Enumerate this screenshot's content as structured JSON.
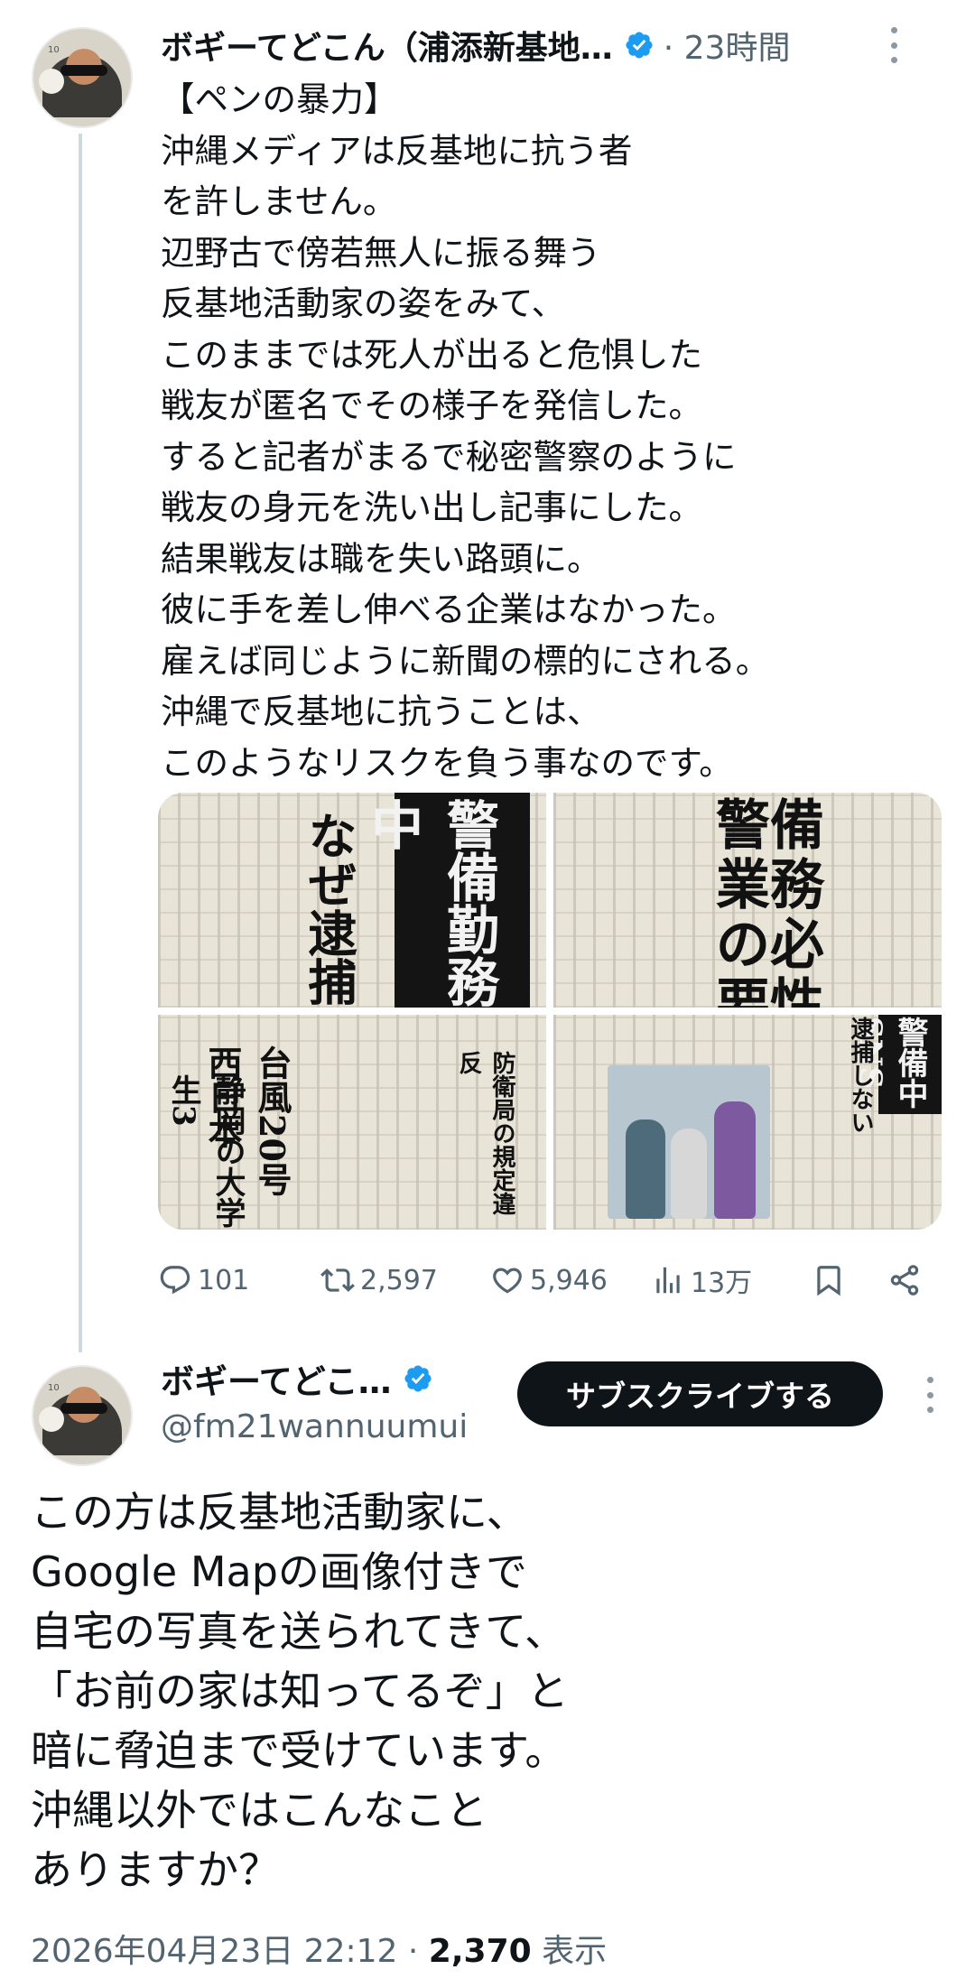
{
  "tweet1": {
    "display_name": "ボギーてどこん（浦添新基地…",
    "verified": true,
    "time_ago": "· 23時間",
    "text": "【ペンの暴力】\n沖縄メディアは反基地に抗う者\nを許しません。\n辺野古で傍若無人に振る舞う\n反基地活動家の姿をみて、\nこのままでは死人が出ると危惧した\n戦友が匿名でその様子を発信した。\nすると記者がまるで秘密警察のように\n戦友の身元を洗い出し記事にした。\n結果戦友は職を失い路頭に。\n彼に手を差し伸べる企業はなかった。\n雇えば同じように新聞の標的にされる。\n沖縄で反基地に抗うことは、\nこのようなリスクを負う事なのです。",
    "images": [
      {
        "headlines": [
          "なぜ逮捕",
          "警備勤務中"
        ]
      },
      {
        "headlines": [
          "警備業務の必要性"
        ]
      },
      {
        "headlines": [
          "台風20号 西日本",
          "静岡の大学生3",
          "防衛局の規定違反"
        ]
      },
      {
        "headlines": [
          "警備中SNS",
          "逮捕しない"
        ]
      }
    ],
    "actions": {
      "replies": "101",
      "reposts": "2,597",
      "likes": "5,946",
      "views": "13万"
    }
  },
  "tweet2": {
    "display_name": "ボギーてどこ…",
    "handle": "@fm21wannuumui",
    "subscribe_label": "サブスクライブする",
    "text": "この方は反基地活動家に、\nGoogle Mapの画像付きで\n自宅の写真を送られてきて、\n「お前の家は知ってるぞ」と\n暗に脅迫まで受けています。\n沖縄以外ではこんなこと\nありますか？",
    "timestamp": "2026年04月23日 22:12",
    "separator": "·",
    "views_count": "2,370",
    "views_label": "表示"
  },
  "colors": {
    "text": "#0f1419",
    "secondary": "#536471",
    "verified_blue": "#1d9bf0",
    "thread_line": "#cfd9de"
  }
}
